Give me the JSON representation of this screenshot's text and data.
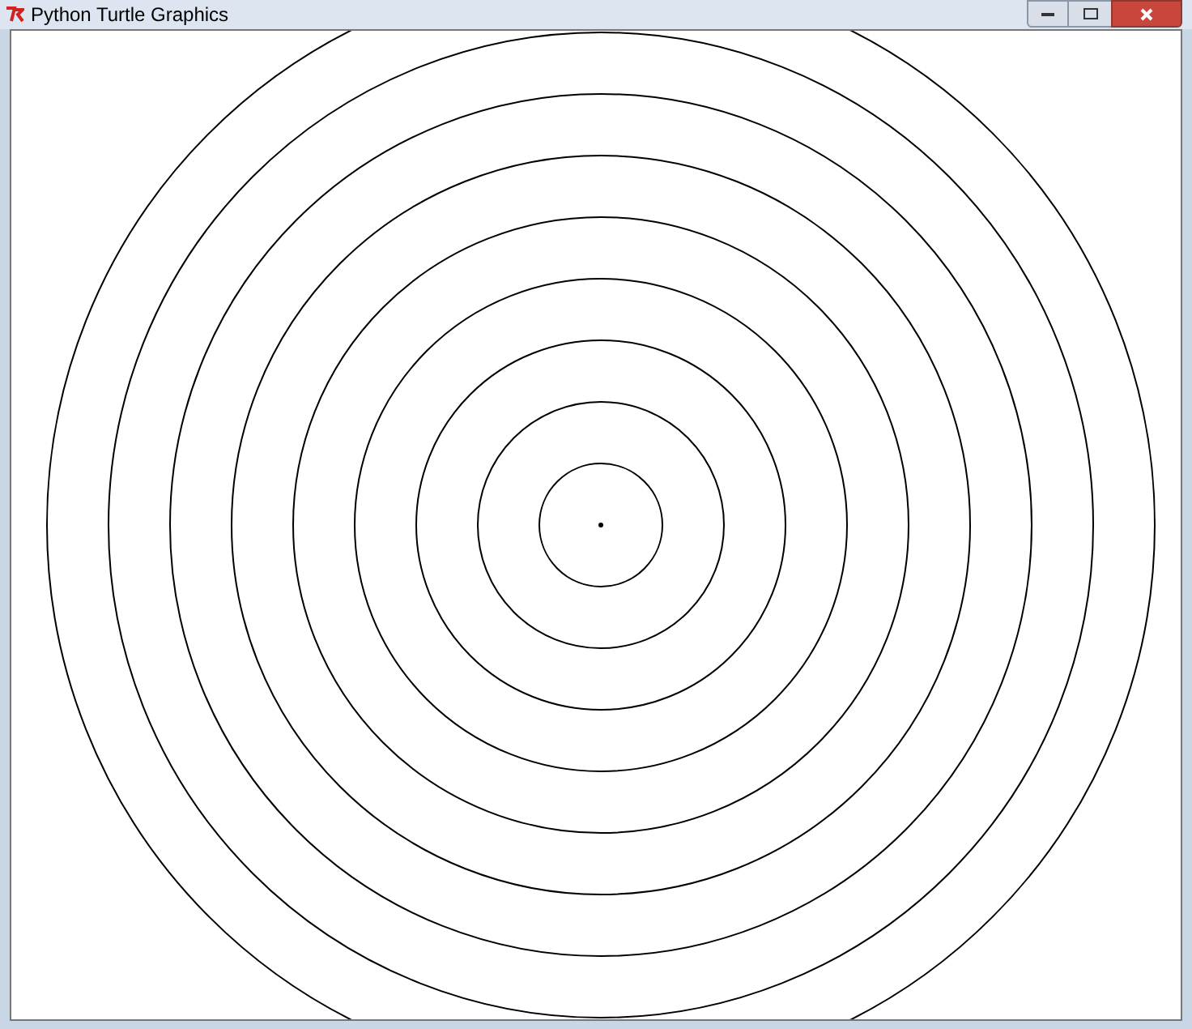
{
  "window": {
    "title": "Python Turtle Graphics"
  }
}
